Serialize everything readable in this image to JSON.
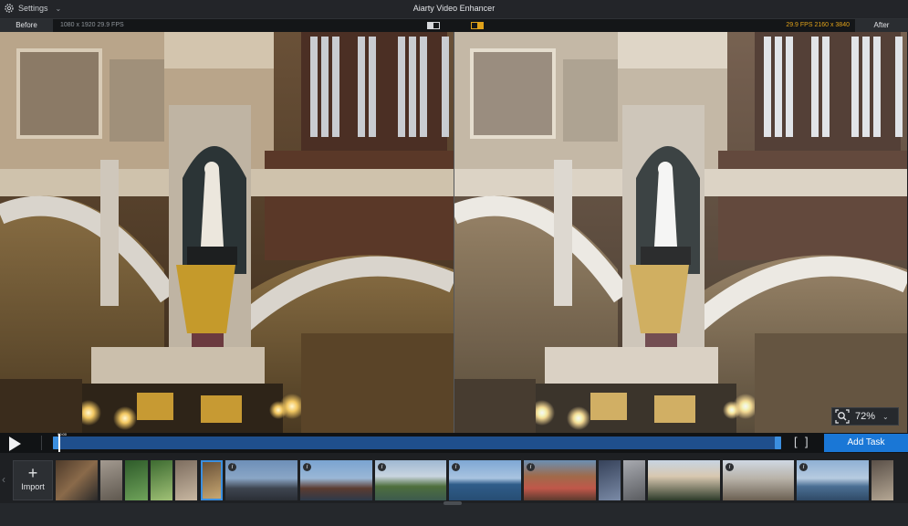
{
  "window": {
    "title": "Aiarty Video Enhancer",
    "settings_label": "Settings"
  },
  "compare": {
    "before_label": "Before",
    "after_label": "After",
    "before_info": "1080 x 1920  29.9 FPS",
    "after_info": "29.9 FPS  2160 x 3840"
  },
  "viewer": {
    "zoom": "72%"
  },
  "transport": {
    "time_marker": "00:00",
    "in_bracket": "[",
    "out_bracket": "]",
    "add_task_label": "Add Task",
    "accent_color": "#1a77d6"
  },
  "media": {
    "import_label": "Import",
    "thumbnails": [
      {
        "type": "video"
      },
      {
        "type": "video"
      },
      {
        "type": "video"
      },
      {
        "type": "video"
      },
      {
        "type": "video"
      },
      {
        "type": "video",
        "selected": true
      },
      {
        "type": "image",
        "badge": "i"
      },
      {
        "type": "image",
        "badge": "i"
      },
      {
        "type": "image",
        "badge": "i"
      },
      {
        "type": "image",
        "badge": "i"
      },
      {
        "type": "image",
        "badge": "i"
      },
      {
        "type": "video"
      },
      {
        "type": "video"
      },
      {
        "type": "video"
      },
      {
        "type": "image",
        "badge": "i"
      },
      {
        "type": "image",
        "badge": "i"
      },
      {
        "type": "video"
      }
    ]
  }
}
